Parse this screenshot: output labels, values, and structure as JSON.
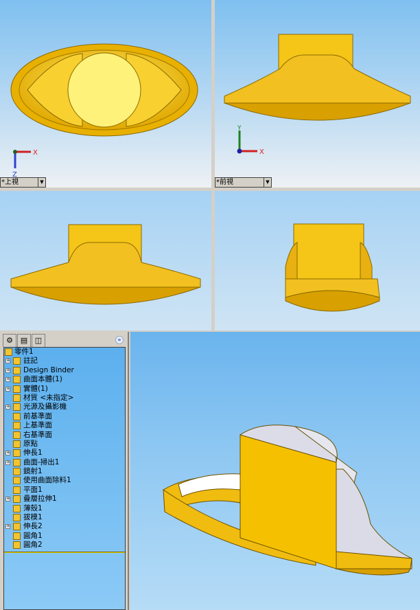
{
  "viewports": {
    "top_left": {
      "label": "*上視",
      "axes": [
        "X",
        "Z"
      ]
    },
    "top_right": {
      "label": "*前視",
      "axes": [
        "X",
        "Y"
      ]
    }
  },
  "feature_tree": {
    "tabs": [
      "feature-manager",
      "property-manager",
      "configuration-manager"
    ],
    "expand_label": "»",
    "root": "零件1",
    "items": [
      {
        "label": "註記",
        "expandable": true,
        "icon": "annotations-icon"
      },
      {
        "label": "Design Binder",
        "expandable": true,
        "icon": "design-binder-icon"
      },
      {
        "label": "曲面本體(1)",
        "expandable": true,
        "icon": "surface-bodies-icon"
      },
      {
        "label": "實體(1)",
        "expandable": true,
        "icon": "solid-bodies-icon"
      },
      {
        "label": "材質 <未指定>",
        "expandable": false,
        "icon": "material-icon"
      },
      {
        "label": "光源及攝影機",
        "expandable": true,
        "icon": "lights-icon"
      },
      {
        "label": "前基準面",
        "expandable": false,
        "icon": "plane-icon"
      },
      {
        "label": "上基準面",
        "expandable": false,
        "icon": "plane-icon"
      },
      {
        "label": "右基準面",
        "expandable": false,
        "icon": "plane-icon"
      },
      {
        "label": "原點",
        "expandable": false,
        "icon": "origin-icon"
      },
      {
        "label": "伸長1",
        "expandable": true,
        "icon": "extrude-icon"
      },
      {
        "label": "曲面-掃出1",
        "expandable": true,
        "icon": "surface-sweep-icon"
      },
      {
        "label": "鏡射1",
        "expandable": false,
        "icon": "mirror-icon"
      },
      {
        "label": "使用曲面除料1",
        "expandable": false,
        "icon": "surface-cut-icon"
      },
      {
        "label": "平面1",
        "expandable": false,
        "icon": "plane-feature-icon"
      },
      {
        "label": "疊層拉伸1",
        "expandable": true,
        "icon": "loft-icon"
      },
      {
        "label": "薄殼1",
        "expandable": false,
        "icon": "shell-icon"
      },
      {
        "label": "拔模1",
        "expandable": false,
        "icon": "draft-icon"
      },
      {
        "label": "伸長2",
        "expandable": true,
        "icon": "extrude-icon"
      },
      {
        "label": "圓角1",
        "expandable": false,
        "icon": "fillet-icon"
      },
      {
        "label": "圓角2",
        "expandable": false,
        "icon": "fillet-icon"
      }
    ]
  },
  "colors": {
    "part": "#f5c518",
    "part_dark": "#c89a00",
    "part_light": "#ffec80"
  }
}
